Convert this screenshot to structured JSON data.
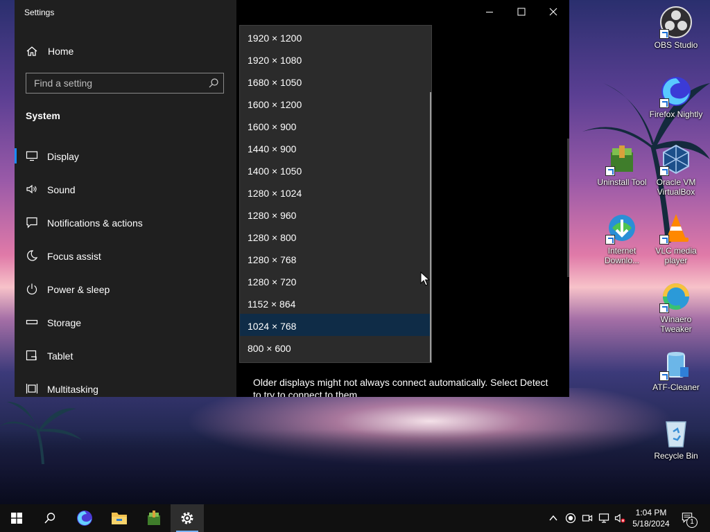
{
  "window": {
    "title": "Settings"
  },
  "sidebar": {
    "home_label": "Home",
    "search_placeholder": "Find a setting",
    "section_title": "System",
    "items": [
      {
        "label": "Display",
        "icon": "monitor-icon",
        "active": true
      },
      {
        "label": "Sound",
        "icon": "speaker-icon",
        "active": false
      },
      {
        "label": "Notifications & actions",
        "icon": "message-icon",
        "active": false
      },
      {
        "label": "Focus assist",
        "icon": "moon-icon",
        "active": false
      },
      {
        "label": "Power & sleep",
        "icon": "power-icon",
        "active": false
      },
      {
        "label": "Storage",
        "icon": "drive-icon",
        "active": false
      },
      {
        "label": "Tablet",
        "icon": "tablet-icon",
        "active": false
      },
      {
        "label": "Multitasking",
        "icon": "multitasking-icon",
        "active": false
      }
    ]
  },
  "resolution_dropdown": {
    "options": [
      "1920 × 1200",
      "1920 × 1080",
      "1680 × 1050",
      "1600 × 1200",
      "1600 × 900",
      "1440 × 900",
      "1400 × 1050",
      "1280 × 1024",
      "1280 × 960",
      "1280 × 800",
      "1280 × 768",
      "1280 × 720",
      "1152 × 864",
      "1024 × 768",
      "800 × 600"
    ],
    "selected": "1024 × 768"
  },
  "main": {
    "info_text": "Older displays might not always connect automatically. Select Detect to try to connect to them."
  },
  "desktop_icons": [
    {
      "label": "OBS Studio",
      "icon": "obs-icon"
    },
    {
      "label": "Firefox Nightly",
      "icon": "firefox-nightly-icon"
    },
    {
      "label": "Uninstall Tool",
      "icon": "uninstall-tool-icon"
    },
    {
      "label": "Oracle VM VirtualBox",
      "icon": "virtualbox-icon"
    },
    {
      "label": "Internet Downlo...",
      "icon": "internet-download-manager-icon"
    },
    {
      "label": "VLC media player",
      "icon": "vlc-icon"
    },
    {
      "label": "Winaero Tweaker",
      "icon": "winaero-tweaker-icon"
    },
    {
      "label": "ATF-Cleaner",
      "icon": "atf-cleaner-icon"
    },
    {
      "label": "Recycle Bin",
      "icon": "recycle-bin-icon"
    }
  ],
  "taskbar": {
    "time": "1:04 PM",
    "date": "5/18/2024",
    "notification_count": "1"
  },
  "colors": {
    "accent": "#1a8cff",
    "sidebar_bg": "#1f1f1f",
    "dropdown_bg": "#2b2b2b",
    "selected_option_bg": "#0f2c47",
    "taskbar_bg": "#101010"
  }
}
